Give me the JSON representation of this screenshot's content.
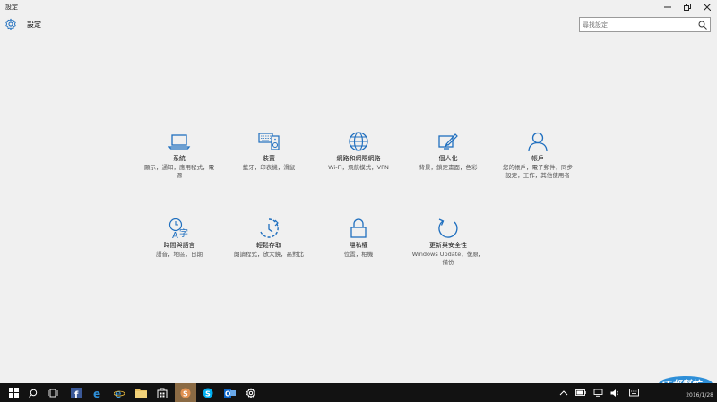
{
  "window": {
    "title": "設定"
  },
  "header": {
    "title": "設定"
  },
  "search": {
    "placeholder": "尋找設定"
  },
  "tiles": [
    {
      "icon": "laptop-icon",
      "name": "系統",
      "desc": "顯示，通知，應用程式，電源"
    },
    {
      "icon": "devices-icon",
      "name": "裝置",
      "desc": "藍牙，印表機，滑鼠"
    },
    {
      "icon": "globe-icon",
      "name": "網路和網際網路",
      "desc": "Wi-Fi，飛航模式，VPN"
    },
    {
      "icon": "personalize-icon",
      "name": "個人化",
      "desc": "背景，鎖定畫面，色彩"
    },
    {
      "icon": "person-icon",
      "name": "帳戶",
      "desc": "您的帳戶，電子郵件，同步設定，工作，其他使用者"
    },
    {
      "icon": "time-language-icon",
      "name": "時間與語言",
      "desc": "語音，地區，日期"
    },
    {
      "icon": "ease-of-access-icon",
      "name": "輕鬆存取",
      "desc": "朗讀程式，放大鏡，高對比"
    },
    {
      "icon": "lock-icon",
      "name": "隱私權",
      "desc": "位置，相機"
    },
    {
      "icon": "sync-icon",
      "name": "更新與安全性",
      "desc": "Windows Update，復原，備份"
    }
  ],
  "taskbar": {
    "date": "2016/1/28"
  },
  "watermark": {
    "text": "iT邦幫忙"
  },
  "colors": {
    "accent": "#1f6fbf",
    "taskbar": "#121212",
    "active_app": "#8a6a44"
  }
}
